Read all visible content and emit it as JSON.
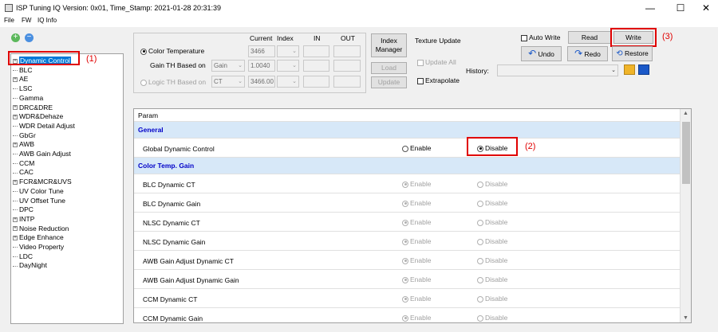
{
  "window": {
    "title": "ISP Tuning IQ Version: 0x01, Time_Stamp: 2021-01-28 20:31:39",
    "controls": {
      "minimize": "—",
      "maximize": "☐",
      "close": "✕"
    }
  },
  "menu": [
    "File",
    "FW",
    "IQ Info"
  ],
  "toolbar_icons": {
    "add": "+",
    "remove": "−"
  },
  "tree": {
    "items": [
      {
        "label": "Dynamic Control",
        "expandable": true,
        "selected": true
      },
      {
        "label": "BLC",
        "expandable": false
      },
      {
        "label": "AE",
        "expandable": true
      },
      {
        "label": "LSC",
        "expandable": false
      },
      {
        "label": "Gamma",
        "expandable": false
      },
      {
        "label": "DRC&DRE",
        "expandable": true
      },
      {
        "label": "WDR&Dehaze",
        "expandable": true
      },
      {
        "label": "WDR Detail Adjust",
        "expandable": false
      },
      {
        "label": "GbGr",
        "expandable": false
      },
      {
        "label": "AWB",
        "expandable": true
      },
      {
        "label": "AWB Gain Adjust",
        "expandable": false
      },
      {
        "label": "CCM",
        "expandable": false
      },
      {
        "label": "CAC",
        "expandable": false
      },
      {
        "label": "FCR&MCR&UVS",
        "expandable": true
      },
      {
        "label": "UV Color Tune",
        "expandable": false
      },
      {
        "label": "UV Offset Tune",
        "expandable": false
      },
      {
        "label": "DPC",
        "expandable": false
      },
      {
        "label": "INTP",
        "expandable": true
      },
      {
        "label": "Noise Reduction",
        "expandable": true
      },
      {
        "label": "Edge Enhance",
        "expandable": true
      },
      {
        "label": "Video Property",
        "expandable": false
      },
      {
        "label": "LDC",
        "expandable": false
      },
      {
        "label": "DayNight",
        "expandable": false
      }
    ]
  },
  "annotations": {
    "a1": "(1)",
    "a2": "(2)",
    "a3": "(3)"
  },
  "params": {
    "headers": {
      "current": "Current",
      "index": "Index",
      "in": "IN",
      "out": "OUT"
    },
    "color_temperature": {
      "label": "Color Temperature",
      "selected": true,
      "current": "3466"
    },
    "gain_th": {
      "label": "Gain TH Based on",
      "select": "Gain",
      "current": "1.0040"
    },
    "logic_th": {
      "label": "Logic TH Based on",
      "selected": false,
      "select": "CT",
      "current": "3466.00"
    },
    "index_manager": "Index\nManager",
    "load": "Load",
    "update": "Update",
    "texture_update": "Texture Update",
    "update_all": "Update All",
    "extrapolate": "Extrapolate"
  },
  "actions": {
    "auto_write": "Auto Write",
    "read": "Read",
    "write": "Write",
    "undo": "Undo",
    "redo": "Redo",
    "restore": "Restore",
    "history_label": "History:",
    "history_value": ""
  },
  "grid": {
    "header": "Param",
    "rows": [
      {
        "type": "section",
        "label": "General"
      },
      {
        "type": "row",
        "label": "Global Dynamic Control",
        "enable": false,
        "disable": true,
        "disabled": false
      },
      {
        "type": "section",
        "label": "Color Temp.  Gain"
      },
      {
        "type": "row",
        "label": "BLC Dynamic CT",
        "enable": true,
        "disable": false,
        "disabled": true
      },
      {
        "type": "row",
        "label": "BLC Dynamic Gain",
        "enable": true,
        "disable": false,
        "disabled": true
      },
      {
        "type": "row",
        "label": "NLSC Dynamic CT",
        "enable": true,
        "disable": false,
        "disabled": true
      },
      {
        "type": "row",
        "label": "NLSC Dynamic Gain",
        "enable": true,
        "disable": false,
        "disabled": true
      },
      {
        "type": "row",
        "label": "AWB Gain Adjust Dynamic CT",
        "enable": true,
        "disable": false,
        "disabled": true
      },
      {
        "type": "row",
        "label": "AWB Gain Adjust Dynamic Gain",
        "enable": true,
        "disable": false,
        "disabled": true
      },
      {
        "type": "row",
        "label": "CCM Dynamic CT",
        "enable": true,
        "disable": false,
        "disabled": true
      },
      {
        "type": "row",
        "label": "CCM Dynamic Gain",
        "enable": true,
        "disable": false,
        "disabled": true
      }
    ],
    "enable_label": "Enable",
    "disable_label": "Disable"
  },
  "colors": {
    "accent_red": "#e00000",
    "selection": "#0078d7",
    "section_bg": "#d7e8f8"
  }
}
